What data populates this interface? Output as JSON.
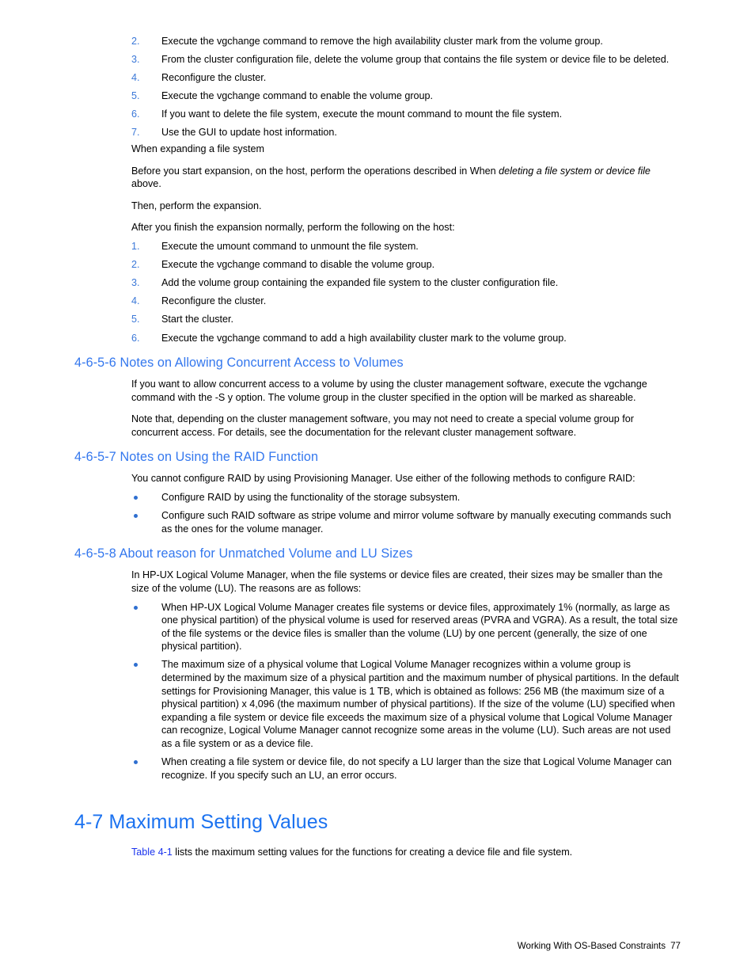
{
  "document": {
    "footer_text": "Working With OS-Based Constraints",
    "page_number": "77"
  },
  "deleting_steps": [
    {
      "num": "2.",
      "text": "Execute the vgchange command to remove the high availability cluster mark from the volume group."
    },
    {
      "num": "3.",
      "text": "From the cluster configuration file, delete the volume group that contains the file system or device file to be deleted."
    },
    {
      "num": "4.",
      "text": "Reconfigure the cluster."
    },
    {
      "num": "5.",
      "text": "Execute the vgchange command to enable the volume group."
    },
    {
      "num": "6.",
      "text": "If you want to delete the file system, execute the mount command to mount the file system."
    },
    {
      "num": "7.",
      "text": "Use the GUI to update host information."
    }
  ],
  "expanding": {
    "lead": "When expanding a file system",
    "before_prefix": "Before you start expansion, on the host, perform the operations described in When ",
    "before_italic": "deleting a file system or device file",
    "before_suffix": " above.",
    "then": "Then, perform the expansion.",
    "after": "After you finish the expansion normally, perform the following on the host:"
  },
  "expanding_steps": [
    {
      "num": "1.",
      "text": "Execute the umount command to unmount the file system."
    },
    {
      "num": "2.",
      "text": "Execute the vgchange command to disable the volume group."
    },
    {
      "num": "3.",
      "text": "Add the volume group containing the expanded file system to the cluster configuration file."
    },
    {
      "num": "4.",
      "text": "Reconfigure the cluster."
    },
    {
      "num": "5.",
      "text": "Start the cluster."
    },
    {
      "num": "6.",
      "text": "Execute the vgchange command to add a high availability cluster mark to the volume group."
    }
  ],
  "section_concurrent": {
    "heading": "4-6-5-6 Notes on Allowing Concurrent Access to Volumes",
    "p1": "If you want to allow concurrent access to a volume by using the cluster management software, execute the vgchange command with the -S y option. The volume group in the cluster specified in the option will be marked as shareable.",
    "p2": "Note that, depending on the cluster management software, you may not need to create a special volume group for concurrent access. For details, see the documentation for the relevant cluster management software."
  },
  "section_raid": {
    "heading": "4-6-5-7 Notes on Using the RAID Function",
    "p1": "You cannot configure RAID by using Provisioning Manager. Use either of the following methods to configure RAID:",
    "bullets": [
      "Configure RAID by using the functionality of the storage subsystem.",
      "Configure such RAID software as stripe volume and mirror volume software by manually executing commands such as the ones for the volume manager."
    ]
  },
  "section_unmatched": {
    "heading": "4-6-5-8 About reason for Unmatched Volume and LU Sizes",
    "p1": "In HP-UX Logical Volume Manager, when the file systems or device files are created, their sizes may be smaller than the size of the volume (LU). The reasons are as follows:",
    "bullets": [
      "When HP-UX Logical Volume Manager creates file systems or device files, approximately 1% (normally, as large as one physical partition) of the physical volume is used for reserved areas (PVRA and VGRA). As a result, the total size of the file systems or the device files is smaller than the volume (LU) by one percent (generally, the size of one physical partition).",
      "The maximum size of a physical volume that Logical Volume Manager recognizes within a volume group is determined by the maximum size of a physical partition and the maximum number of physical partitions. In the default settings for Provisioning Manager, this value is 1 TB, which is obtained as follows: 256 MB (the maximum size of a physical partition) x 4,096 (the maximum number of physical partitions). If the size of the volume (LU) specified when expanding a file system or device file exceeds the maximum size of a physical volume that Logical Volume Manager can recognize, Logical Volume Manager cannot recognize some areas in the volume (LU). Such areas are not used as a file system or as a device file.",
      "When creating a file system or device file, do not specify a LU larger than the size that Logical Volume Manager can recognize. If you specify such an LU, an error occurs."
    ]
  },
  "section_max": {
    "heading": "4-7 Maximum Setting Values",
    "link_text": "Table 4-1",
    "p1_suffix": " lists the maximum setting values for the functions for creating a device file and file system."
  },
  "colors": {
    "heading_blue": "#3377ee",
    "chapter_blue": "#1b72f0",
    "marker_blue": "#3b78d8",
    "bullet_blue": "#2f6fd0",
    "link_blue": "#1a33ee",
    "body_black": "#000000"
  }
}
